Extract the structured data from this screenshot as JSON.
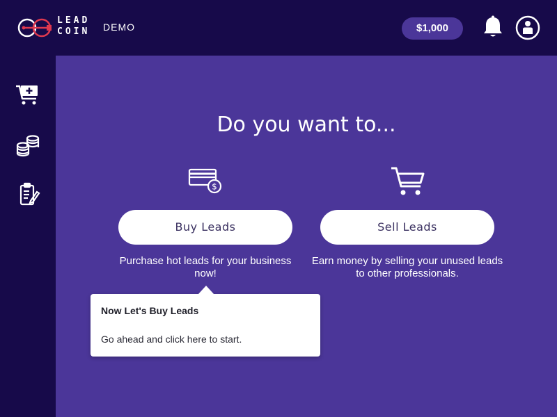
{
  "brand": {
    "logo_lines": [
      "LEAD",
      "COIN"
    ],
    "mode_label": "DEMO"
  },
  "header": {
    "balance": "$1,000",
    "icons": [
      "bell-icon",
      "account-icon"
    ]
  },
  "sidebar": {
    "items": [
      {
        "icon": "cart-add-icon"
      },
      {
        "icon": "coins-icon"
      },
      {
        "icon": "clipboard-edit-icon"
      }
    ]
  },
  "main": {
    "heading": "Do you want to...",
    "options": [
      {
        "icon": "credit-card-dollar-icon",
        "label": "Buy Leads",
        "description": "Purchase hot leads for your business now!"
      },
      {
        "icon": "shopping-cart-icon",
        "label": "Sell Leads",
        "description": "Earn money by selling your unused leads to other professionals."
      }
    ]
  },
  "tooltip": {
    "title": "Now Let's Buy Leads",
    "body": "Go ahead and click here to start."
  },
  "colors": {
    "nav_bg": "#170a4a",
    "main_bg": "#4b3699",
    "accent_red": "#e0394f",
    "white": "#ffffff"
  }
}
